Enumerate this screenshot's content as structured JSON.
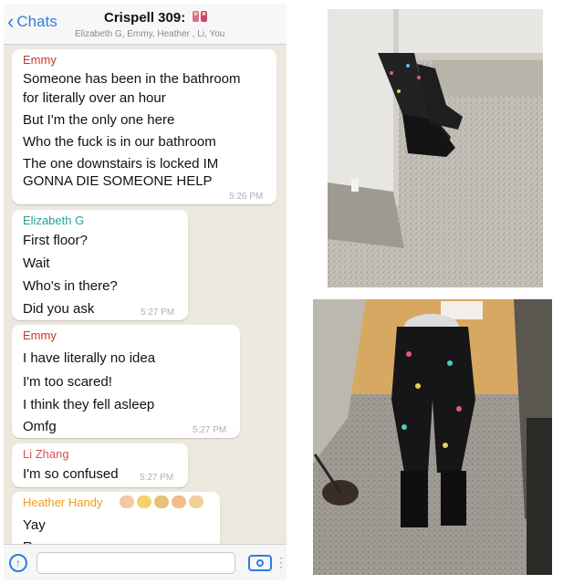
{
  "header": {
    "back_label": "Chats",
    "title": "Crispell 309:",
    "participants": "Elizabeth G, Emmy, Heather , Li, You"
  },
  "messages": [
    {
      "sender": "Emmy",
      "sender_color": "#c0392b",
      "lines": [
        "Someone has been in the bathroom",
        "for literally over an hour",
        "But I'm the only one here",
        "Who the fuck is in our bathroom",
        "The one downstairs is locked IM",
        "GONNA DIE SOMEONE HELP"
      ],
      "time": "5:26 PM"
    },
    {
      "sender": "Elizabeth G",
      "sender_color": "#2aa198",
      "lines": [
        "First floor?",
        "Wait",
        "Who's in there?",
        "Did you ask"
      ],
      "time": "5:27 PM"
    },
    {
      "sender": "Emmy",
      "sender_color": "#c0392b",
      "lines": [
        "I have literally no idea",
        "I'm too scared!",
        "I think they fell asleep",
        "Omfg"
      ],
      "time": "5:27 PM"
    },
    {
      "sender": "Li Zhang",
      "sender_color": "#d9534f",
      "lines": [
        "I'm so confused"
      ],
      "time": "5:27 PM"
    },
    {
      "sender": "Heather  Handy",
      "sender_color": "#f39c12",
      "lines": [
        "Yay",
        "Rooo"
      ],
      "time": ""
    }
  ],
  "input": {
    "placeholder": ""
  },
  "icons": {
    "back": "chevron-left-icon",
    "up": "arrow-up-circle-icon",
    "camera": "camera-icon"
  },
  "colors": {
    "accent": "#2f7de1",
    "chat_bg": "#ede8de"
  }
}
